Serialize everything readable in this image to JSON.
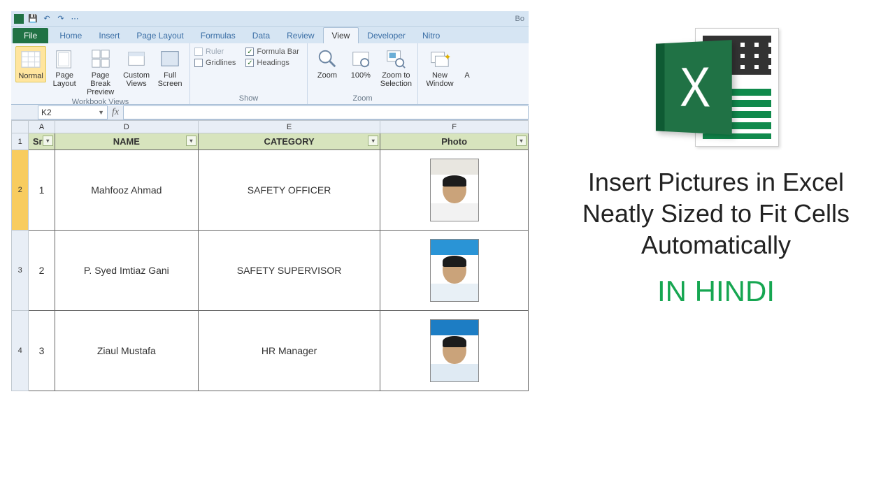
{
  "qat": {
    "title_tail": "Bo"
  },
  "tabs": {
    "file": "File",
    "items": [
      "Home",
      "Insert",
      "Page Layout",
      "Formulas",
      "Data",
      "Review",
      "View",
      "Developer",
      "Nitro"
    ],
    "active": "View"
  },
  "ribbon": {
    "views": {
      "group_label": "Workbook Views",
      "normal": "Normal",
      "page_layout": "Page Layout",
      "page_break": "Page Break Preview",
      "custom": "Custom Views",
      "full": "Full Screen"
    },
    "show": {
      "group_label": "Show",
      "ruler": "Ruler",
      "formula_bar": "Formula Bar",
      "gridlines": "Gridlines",
      "headings": "Headings"
    },
    "zoom": {
      "group_label": "Zoom",
      "zoom": "Zoom",
      "hundred": "100%",
      "to_sel": "Zoom to Selection"
    },
    "window": {
      "new_window": "New Window",
      "arrange_tail": "A"
    }
  },
  "formula_bar": {
    "namebox": "K2"
  },
  "sheet": {
    "col_letters": [
      "A",
      "D",
      "E",
      "F"
    ],
    "row_numbers": [
      "1",
      "2",
      "3",
      "4"
    ],
    "headers": {
      "sr": "Sr n",
      "name": "NAME",
      "category": "CATEGORY",
      "photo": "Photo"
    },
    "rows": [
      {
        "sr": "1",
        "name": "Mahfooz Ahmad",
        "category": "SAFETY OFFICER"
      },
      {
        "sr": "2",
        "name": "P. Syed Imtiaz Gani",
        "category": "SAFETY SUPERVISOR"
      },
      {
        "sr": "3",
        "name": "Ziaul Mustafa",
        "category": "HR Manager"
      }
    ]
  },
  "promo": {
    "logo_letter": "X",
    "title_line1": "Insert Pictures in Excel",
    "title_line2": "Neatly Sized to Fit Cells",
    "title_line3": "Automatically",
    "subtitle": "IN HINDI"
  }
}
